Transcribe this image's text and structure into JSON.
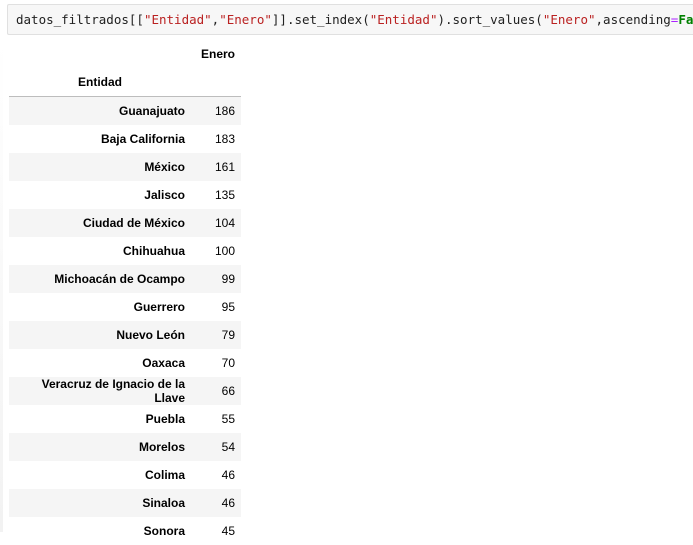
{
  "code_cell": {
    "prefix": "datos_filtrados[[",
    "str_entidad": "\"Entidad\"",
    "comma1": ",",
    "str_enero": "\"Enero\"",
    "mid1": "]].set_index(",
    "str_entidad2": "\"Entidad\"",
    "mid2": ").sort_values(",
    "str_enero2": "\"Enero\"",
    "mid3": ",ascending",
    "eq": "=",
    "kw_false": "False",
    "suffix": ")"
  },
  "table": {
    "column_header": "Enero",
    "index_name": "Entidad",
    "rows": [
      {
        "entidad": "Guanajuato",
        "enero": "186"
      },
      {
        "entidad": "Baja California",
        "enero": "183"
      },
      {
        "entidad": "México",
        "enero": "161"
      },
      {
        "entidad": "Jalisco",
        "enero": "135"
      },
      {
        "entidad": "Ciudad de México",
        "enero": "104"
      },
      {
        "entidad": "Chihuahua",
        "enero": "100"
      },
      {
        "entidad": "Michoacán de Ocampo",
        "enero": "99"
      },
      {
        "entidad": "Guerrero",
        "enero": "95"
      },
      {
        "entidad": "Nuevo León",
        "enero": "79"
      },
      {
        "entidad": "Oaxaca",
        "enero": "70"
      },
      {
        "entidad": "Veracruz de Ignacio de la Llave",
        "enero": "66"
      },
      {
        "entidad": "Puebla",
        "enero": "55"
      },
      {
        "entidad": "Morelos",
        "enero": "54"
      },
      {
        "entidad": "Colima",
        "enero": "46"
      },
      {
        "entidad": "Sinaloa",
        "enero": "46"
      },
      {
        "entidad": "Sonora",
        "enero": "45"
      }
    ]
  },
  "colors": {
    "string": "#ba2121",
    "keyword": "#008000",
    "operator": "#aa22ff",
    "row_stripe": "#f5f5f5"
  }
}
